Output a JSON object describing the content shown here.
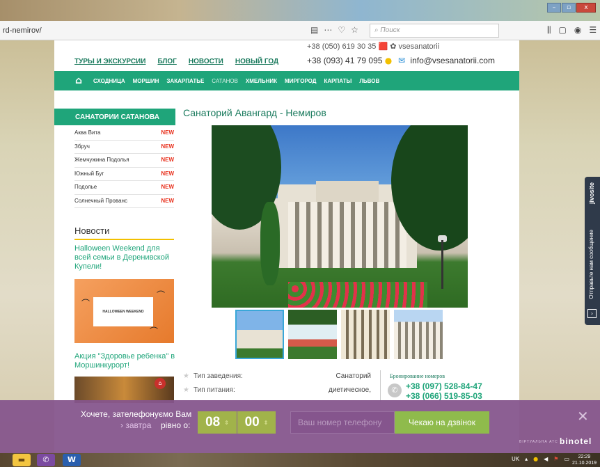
{
  "browser": {
    "url": "rd-nemirov/",
    "search_placeholder": "Поиск",
    "url_icons": [
      "▤",
      "⋯",
      "♡",
      "☆"
    ],
    "tool_icons": [
      "⫼",
      "▢",
      "◉",
      "☰"
    ],
    "window_buttons": [
      "–",
      "▫",
      "x"
    ]
  },
  "header": {
    "topnav": [
      "ТУРЫ И ЭКСКУРСИИ",
      "БЛОГ",
      "НОВОСТИ",
      "НОВЫЙ ГОД"
    ],
    "contact_top": "+38 (050) 619 30 35 🟥  ✿ vsesanatorii",
    "phone2": "+38 (093) 41 79 095",
    "email2": "info@vsesanatorii.com"
  },
  "greennav": {
    "items": [
      "СХОДНИЦА",
      "МОРШИН",
      "ЗАКАРПАТЬЕ",
      "САТАНОВ",
      "ХМЕЛЬНИК",
      "МИРГОРОД",
      "КАРПАТЫ",
      "ЛЬВОВ"
    ]
  },
  "sidebar": {
    "heading": "САНАТОРИИ САТАНОВА",
    "items": [
      {
        "label": "Аква Вита",
        "badge": "NEW"
      },
      {
        "label": "Збруч",
        "badge": "NEW"
      },
      {
        "label": "Жемчужина Подолья",
        "badge": "NEW"
      },
      {
        "label": "Южный Буг",
        "badge": "NEW"
      },
      {
        "label": "Подолье",
        "badge": "NEW"
      },
      {
        "label": "Солнечный Прованс",
        "badge": "NEW"
      }
    ],
    "news_title": "Новости",
    "news1": "Halloween Weekend для всей семьи в Деренивской Купели!",
    "halloween_card": "HALLOWEEN WEEKEND",
    "news2": "Акция \"Здоровье ребенка\" в Моршинкурорт!"
  },
  "main": {
    "title": "Санаторий Авангард - Немиров",
    "info": [
      {
        "label": "Тип заведения:",
        "value": "Санаторий"
      },
      {
        "label": "Тип питания:",
        "value": "диетическое,"
      }
    ],
    "booking_label": "Бронирование номеров",
    "booking_phone1": "+38 (097) 528-84-47",
    "booking_phone2": "+38 (066) 519-85-03"
  },
  "jivo": {
    "brand": "jivosite",
    "text": "Отправьте нам сообщение"
  },
  "callback": {
    "text1": "Хочете, зателефонуємо Вам",
    "when": "› завтра",
    "at": "рівно о:",
    "hour": "08",
    "minute": "00",
    "phone_placeholder": "Ваш номер телефону",
    "button": "Чекаю на дзвінок",
    "binotel_sub": "ВІРТУАЛЬНА АТС",
    "binotel": "binotel"
  },
  "taskbar": {
    "lang": "UK",
    "time": "22:29",
    "date": "21.10.2019"
  }
}
